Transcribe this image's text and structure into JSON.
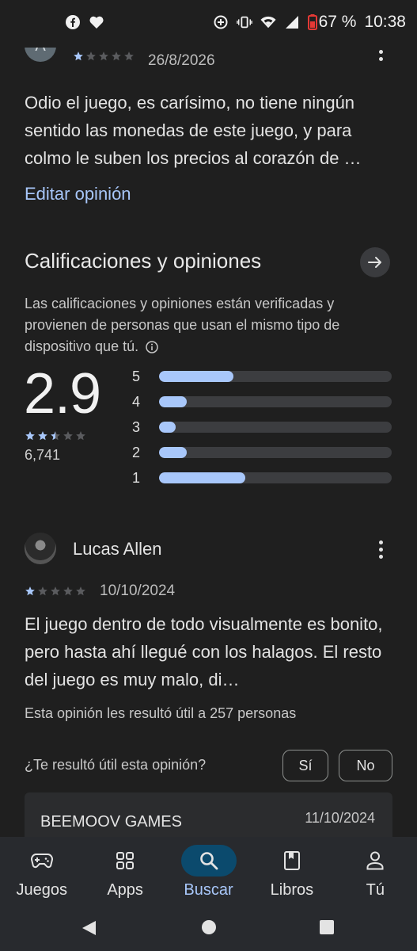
{
  "status_bar": {
    "battery": "67 %",
    "time": "10:38"
  },
  "top_review": {
    "avatar_letter": "A",
    "rating": 1,
    "date": "26/8/2026",
    "text": "Odio el juego, es carísimo, no tiene ningún sentido las monedas de este juego, y para colmo le suben los precios al corazón de …",
    "edit_label": "Editar opinión"
  },
  "ratings_section": {
    "title": "Calificaciones y opiniones",
    "description": "Las calificaciones y opiniones están verificadas y provienen de personas que usan el mismo tipo de dispositivo que tú.",
    "average": "2.9",
    "average_stars": 2.5,
    "count": "6,741",
    "distribution": [
      {
        "label": "5",
        "fraction": 0.32
      },
      {
        "label": "4",
        "fraction": 0.12
      },
      {
        "label": "3",
        "fraction": 0.07
      },
      {
        "label": "2",
        "fraction": 0.12
      },
      {
        "label": "1",
        "fraction": 0.37
      }
    ]
  },
  "review": {
    "author": "Lucas Allen",
    "rating": 1,
    "date": "10/10/2024",
    "text": "El juego dentro de todo visualmente es bonito, pero hasta ahí llegué con los halagos. El resto del juego es muy malo, di…",
    "helpful_count": "Esta opinión les resultó útil a 257 personas",
    "helpful_question": "¿Te resultó útil esta opinión?",
    "yes_label": "Sí",
    "no_label": "No",
    "developer_reply": {
      "name": "BEEMOOV GAMES",
      "date": "11/10/2024"
    }
  },
  "bottom_nav": {
    "items": [
      {
        "label": "Juegos",
        "icon": "gamepad-icon"
      },
      {
        "label": "Apps",
        "icon": "apps-grid-icon"
      },
      {
        "label": "Buscar",
        "icon": "search-icon",
        "active": true
      },
      {
        "label": "Libros",
        "icon": "book-icon"
      },
      {
        "label": "Tú",
        "icon": "person-icon"
      }
    ]
  },
  "colors": {
    "accent": "#a8c7fa",
    "background": "#1f1f1f",
    "active_nav": "#0b4a6d"
  }
}
